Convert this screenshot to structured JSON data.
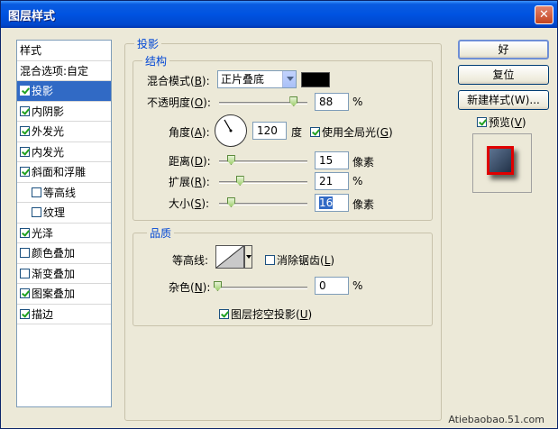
{
  "window": {
    "title": "图层样式",
    "close_glyph": "✕"
  },
  "sidebar": {
    "items": [
      {
        "label": "样式",
        "checkbox": false,
        "checked": false,
        "indent": false,
        "selected": false
      },
      {
        "label": "混合选项:自定",
        "checkbox": false,
        "checked": false,
        "indent": false,
        "selected": false
      },
      {
        "label": "投影",
        "checkbox": true,
        "checked": true,
        "indent": false,
        "selected": true
      },
      {
        "label": "内阴影",
        "checkbox": true,
        "checked": true,
        "indent": false,
        "selected": false
      },
      {
        "label": "外发光",
        "checkbox": true,
        "checked": true,
        "indent": false,
        "selected": false
      },
      {
        "label": "内发光",
        "checkbox": true,
        "checked": true,
        "indent": false,
        "selected": false
      },
      {
        "label": "斜面和浮雕",
        "checkbox": true,
        "checked": true,
        "indent": false,
        "selected": false
      },
      {
        "label": "等高线",
        "checkbox": true,
        "checked": false,
        "indent": true,
        "selected": false
      },
      {
        "label": "纹理",
        "checkbox": true,
        "checked": false,
        "indent": true,
        "selected": false
      },
      {
        "label": "光泽",
        "checkbox": true,
        "checked": true,
        "indent": false,
        "selected": false
      },
      {
        "label": "颜色叠加",
        "checkbox": true,
        "checked": false,
        "indent": false,
        "selected": false
      },
      {
        "label": "渐变叠加",
        "checkbox": true,
        "checked": false,
        "indent": false,
        "selected": false
      },
      {
        "label": "图案叠加",
        "checkbox": true,
        "checked": true,
        "indent": false,
        "selected": false
      },
      {
        "label": "描边",
        "checkbox": true,
        "checked": true,
        "indent": false,
        "selected": false
      }
    ]
  },
  "shadow": {
    "group_title": "投影",
    "structure_title": "结构",
    "blend_mode": {
      "label": "混合模式(",
      "key": "B",
      "suffix": "):",
      "value": "正片叠底",
      "color": "#000000"
    },
    "opacity": {
      "label": "不透明度(",
      "key": "O",
      "suffix": "):",
      "value": "88",
      "unit": "%",
      "level": 0.88
    },
    "angle": {
      "label": "角度(",
      "key": "A",
      "suffix": "):",
      "value": "120",
      "unit": "度",
      "degrees": 120
    },
    "global_light": {
      "label": "使用全局光(",
      "key": "G",
      "suffix": ")",
      "checked": true
    },
    "distance": {
      "label": "距离(",
      "key": "D",
      "suffix": "):",
      "value": "15",
      "unit": "像素",
      "level": 0.1
    },
    "spread": {
      "label": "扩展(",
      "key": "R",
      "suffix": "):",
      "value": "21",
      "unit": "%",
      "level": 0.21
    },
    "size": {
      "label": "大小(",
      "key": "S",
      "suffix": "):",
      "value": "16",
      "unit": "像素",
      "level": 0.1
    }
  },
  "quality": {
    "title": "品质",
    "contour": {
      "label": "等高线:"
    },
    "anti_alias": {
      "label": "消除锯齿(",
      "key": "L",
      "suffix": ")",
      "checked": false
    },
    "noise": {
      "label": "杂色(",
      "key": "N",
      "suffix": "):",
      "value": "0",
      "unit": "%",
      "level": 0
    }
  },
  "knockout": {
    "label": "图层挖空投影(",
    "key": "U",
    "suffix": ")",
    "checked": true
  },
  "buttons": {
    "ok": "好",
    "reset": "复位",
    "new_style": "新建样式(W)..."
  },
  "preview": {
    "label": "预览(",
    "key": "V",
    "suffix": ")",
    "checked": true
  },
  "watermark": "Atiebaobao.51.com"
}
